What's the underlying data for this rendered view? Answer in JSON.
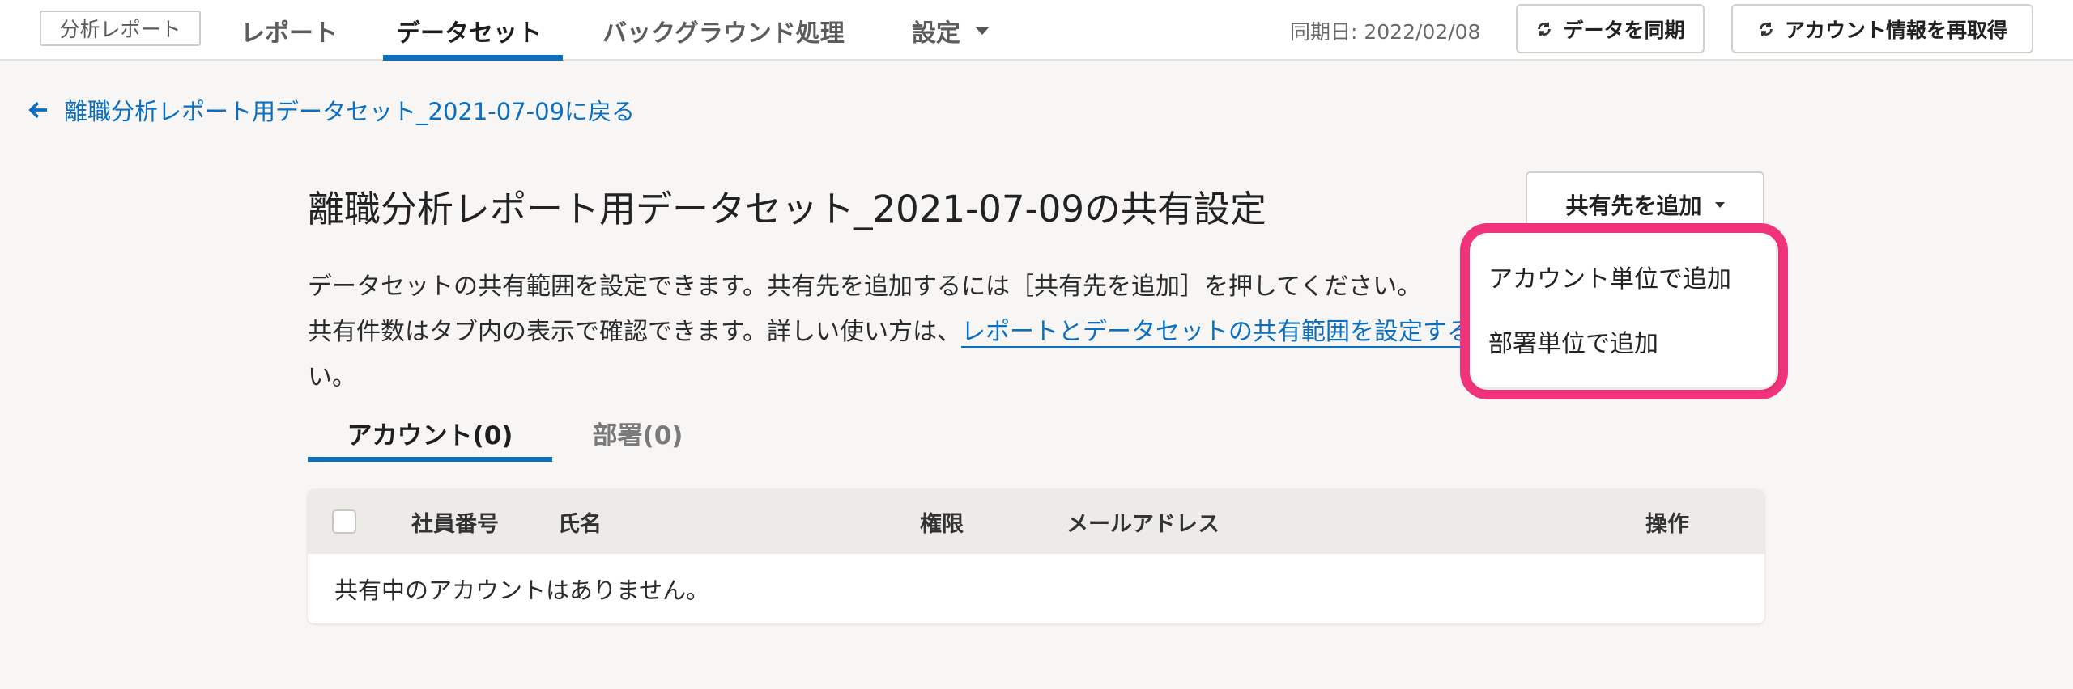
{
  "header": {
    "app_name": "分析レポート",
    "nav": [
      {
        "label": "レポート"
      },
      {
        "label": "データセット"
      },
      {
        "label": "バックグラウンド処理"
      },
      {
        "label": "設定"
      }
    ],
    "sync_date": "同期日: 2022/02/08",
    "sync_button": "データを同期",
    "refetch_button": "アカウント情報を再取得"
  },
  "back_link": "離職分析レポート用データセット_2021-07-09に戻る",
  "page": {
    "title": "離職分析レポート用データセットの共有設定",
    "title_full": "離職分析レポート用データセット_2021-07-09の共有設定",
    "add_share_button": "共有先を追加",
    "description_line1": "データセットの共有範囲を設定できます。共有先を追加するには［共有先を追加］を押してください。",
    "description_line2_prefix": "共有件数はタブ内の表示で確認できます。詳しい使い方は、",
    "description_link": "レポートとデータセットの共有範囲を設定する",
    "description_line3": "い。"
  },
  "tabs": [
    {
      "label": "アカウント(0)"
    },
    {
      "label": "部署(0)"
    }
  ],
  "table": {
    "columns": [
      "社員番号",
      "氏名",
      "権限",
      "メールアドレス",
      "操作"
    ],
    "empty_message": "共有中のアカウントはありません。"
  },
  "dropdown": {
    "items": [
      "アカウント単位で追加",
      "部署単位で追加"
    ]
  },
  "colors": {
    "accent": "#0a6fc2",
    "highlight": "#f0337a"
  }
}
